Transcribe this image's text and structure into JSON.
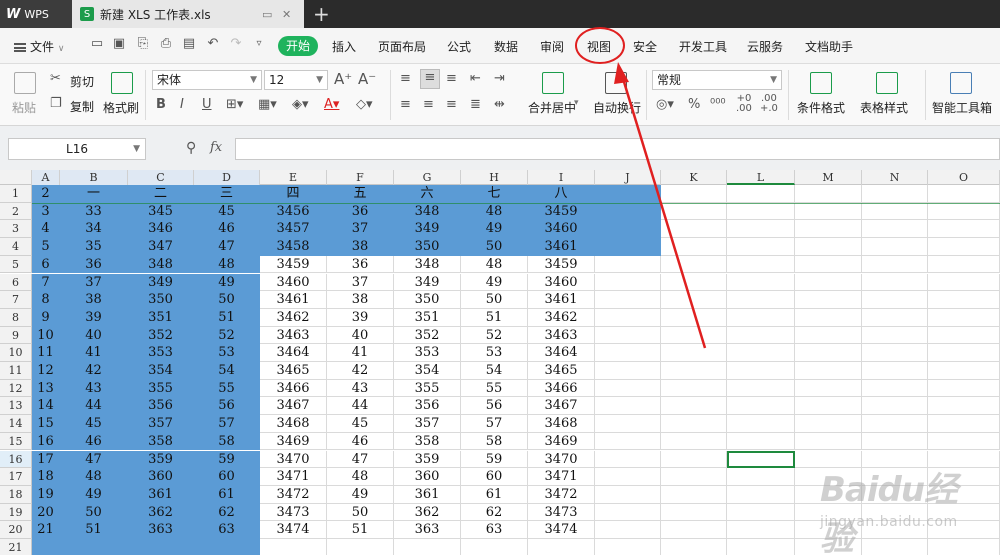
{
  "titlebar": {
    "app_tab": "WPS",
    "doc_tab": "新建 XLS 工作表.xls",
    "new_tab": "+"
  },
  "menubar": {
    "file": "文件",
    "tabs": [
      "开始",
      "插入",
      "页面布局",
      "公式",
      "数据",
      "审阅",
      "视图",
      "安全",
      "开发工具",
      "云服务",
      "文档助手"
    ]
  },
  "ribbon": {
    "paste": "粘贴",
    "cut": "剪切",
    "copy": "复制",
    "format_painter": "格式刷",
    "font_name": "宋体",
    "font_size": "12",
    "merge_center": "合并居中",
    "wrap_text": "自动换行",
    "number_format": "常规",
    "conditional_format": "条件格式",
    "table_style": "表格样式",
    "smart_toolbox": "智能工具箱"
  },
  "formulabar": {
    "cell_ref": "L16",
    "fx": "fx",
    "value": ""
  },
  "sheet": {
    "columns": [
      "A",
      "B",
      "C",
      "D",
      "E",
      "F",
      "G",
      "H",
      "I",
      "J",
      "K",
      "L",
      "M",
      "N",
      "O"
    ],
    "row_numbers": [
      "1",
      "2",
      "3",
      "4",
      "5",
      "6",
      "7",
      "8",
      "9",
      "10",
      "11",
      "12",
      "13",
      "14",
      "15",
      "16",
      "17",
      "18",
      "19",
      "20",
      "21"
    ],
    "rows": [
      [
        "2",
        "一",
        "二",
        "三",
        "四",
        "五",
        "六",
        "七",
        "八"
      ],
      [
        "3",
        "33",
        "345",
        "45",
        "3456",
        "36",
        "348",
        "48",
        "3459"
      ],
      [
        "4",
        "34",
        "346",
        "46",
        "3457",
        "37",
        "349",
        "49",
        "3460"
      ],
      [
        "5",
        "35",
        "347",
        "47",
        "3458",
        "38",
        "350",
        "50",
        "3461"
      ],
      [
        "6",
        "36",
        "348",
        "48",
        "3459",
        "36",
        "348",
        "48",
        "3459"
      ],
      [
        "7",
        "37",
        "349",
        "49",
        "3460",
        "37",
        "349",
        "49",
        "3460"
      ],
      [
        "8",
        "38",
        "350",
        "50",
        "3461",
        "38",
        "350",
        "50",
        "3461"
      ],
      [
        "9",
        "39",
        "351",
        "51",
        "3462",
        "39",
        "351",
        "51",
        "3462"
      ],
      [
        "10",
        "40",
        "352",
        "52",
        "3463",
        "40",
        "352",
        "52",
        "3463"
      ],
      [
        "11",
        "41",
        "353",
        "53",
        "3464",
        "41",
        "353",
        "53",
        "3464"
      ],
      [
        "12",
        "42",
        "354",
        "54",
        "3465",
        "42",
        "354",
        "54",
        "3465"
      ],
      [
        "13",
        "43",
        "355",
        "55",
        "3466",
        "43",
        "355",
        "55",
        "3466"
      ],
      [
        "14",
        "44",
        "356",
        "56",
        "3467",
        "44",
        "356",
        "56",
        "3467"
      ],
      [
        "15",
        "45",
        "357",
        "57",
        "3468",
        "45",
        "357",
        "57",
        "3468"
      ],
      [
        "16",
        "46",
        "358",
        "58",
        "3469",
        "46",
        "358",
        "58",
        "3469"
      ],
      [
        "17",
        "47",
        "359",
        "59",
        "3470",
        "47",
        "359",
        "59",
        "3470"
      ],
      [
        "18",
        "48",
        "360",
        "60",
        "3471",
        "48",
        "360",
        "60",
        "3471"
      ],
      [
        "19",
        "49",
        "361",
        "61",
        "3472",
        "49",
        "361",
        "61",
        "3472"
      ],
      [
        "20",
        "50",
        "362",
        "62",
        "3473",
        "50",
        "362",
        "62",
        "3473"
      ],
      [
        "21",
        "51",
        "363",
        "63",
        "3474",
        "51",
        "363",
        "63",
        "3474"
      ],
      [
        "",
        "",
        "",
        "",
        "",
        "",
        "",
        "",
        ""
      ]
    ],
    "active_cell": "L16"
  },
  "colors": {
    "selection": "#5b9bd5",
    "accent_green": "#1fb35d",
    "annotation_red": "#e02020"
  },
  "watermark": {
    "logo": "Baidu经验",
    "url": "jingyan.baidu.com"
  }
}
